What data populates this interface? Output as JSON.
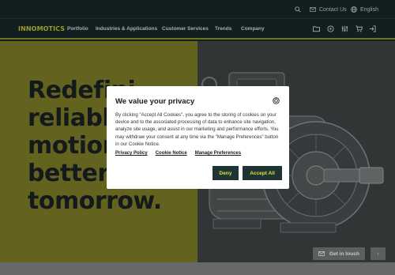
{
  "topbar": {
    "contact_label": "Contact Us",
    "language_label": "English"
  },
  "nav": {
    "logo": "INNOMOTICS",
    "links": [
      "Portfolio",
      "Industries & Applications",
      "Customer Services",
      "Trends",
      "Company"
    ]
  },
  "hero": {
    "headline_lines": [
      "Redefini",
      "reliable",
      "motion",
      "better",
      "tomorrow."
    ]
  },
  "cookie_modal": {
    "title": "We value your privacy",
    "body": "By clicking \"Accept All Cookies\", you agree to the storing of cookies on your device and to the associated processing of data to enhance site navigation, analyze site usage, and assist in our marketing and performance efforts. You may withdraw your consent at any time via the \"Manage Preferences\" button in our Cookie Notice.",
    "links": [
      "Privacy Policy",
      "Cookie Notice",
      "Manage Preferences"
    ],
    "deny_label": "Deny",
    "accept_label": "Accept All"
  },
  "floating": {
    "get_in_touch_label": "Get in touch",
    "scroll_top_label": "↑"
  },
  "colors": {
    "brand_lime": "#d4dc2e",
    "dark_teal": "#1a2a2c",
    "hero_olive": "#8a8a2c"
  }
}
